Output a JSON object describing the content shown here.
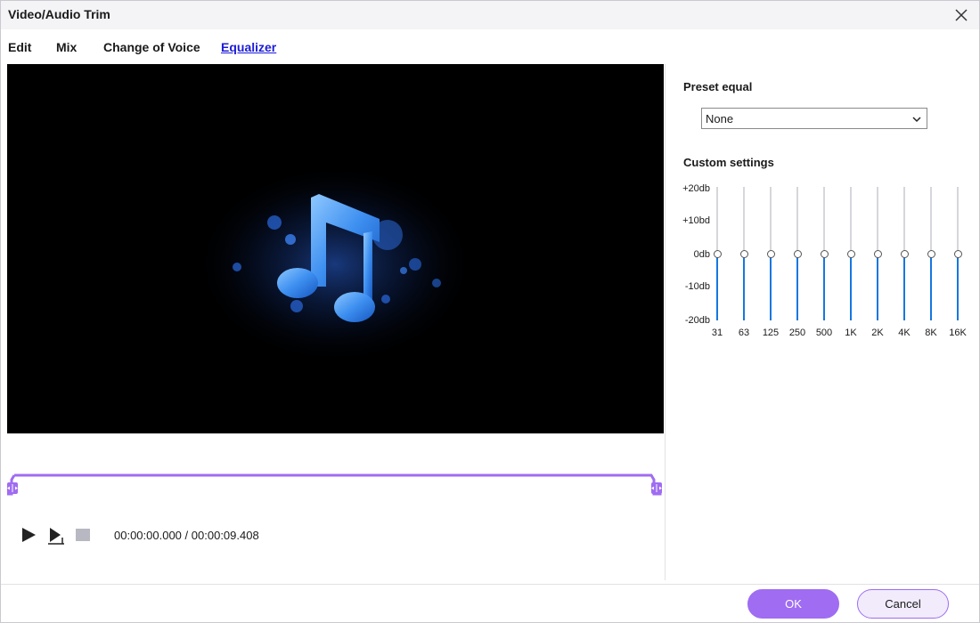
{
  "window": {
    "title": "Video/Audio Trim"
  },
  "tabs": [
    {
      "label": "Edit",
      "active": false
    },
    {
      "label": "Mix",
      "active": false
    },
    {
      "label": "Change of Voice",
      "active": false
    },
    {
      "label": "Equalizer",
      "active": true
    }
  ],
  "preview": {
    "icon": "music-note-icon"
  },
  "playback": {
    "current_time": "00:00:00.000",
    "separator": "/",
    "total_time": "00:00:09.408"
  },
  "equalizer": {
    "preset_label": "Preset equal",
    "preset_value": "None",
    "custom_label": "Custom settings",
    "scale_labels": [
      "+20db",
      "+10bd",
      "0db",
      "-10db",
      "-20db"
    ],
    "bands": [
      {
        "freq": "31",
        "gain_db": 0
      },
      {
        "freq": "63",
        "gain_db": 0
      },
      {
        "freq": "125",
        "gain_db": 0
      },
      {
        "freq": "250",
        "gain_db": 0
      },
      {
        "freq": "500",
        "gain_db": 0
      },
      {
        "freq": "1K",
        "gain_db": 0
      },
      {
        "freq": "2K",
        "gain_db": 0
      },
      {
        "freq": "4K",
        "gain_db": 0
      },
      {
        "freq": "8K",
        "gain_db": 0
      },
      {
        "freq": "16K",
        "gain_db": 0
      }
    ]
  },
  "buttons": {
    "ok": "OK",
    "cancel": "Cancel"
  },
  "colors": {
    "accent": "#9f6cf2",
    "slider_fill": "#1677e0",
    "active_tab": "#1c1cd6"
  }
}
